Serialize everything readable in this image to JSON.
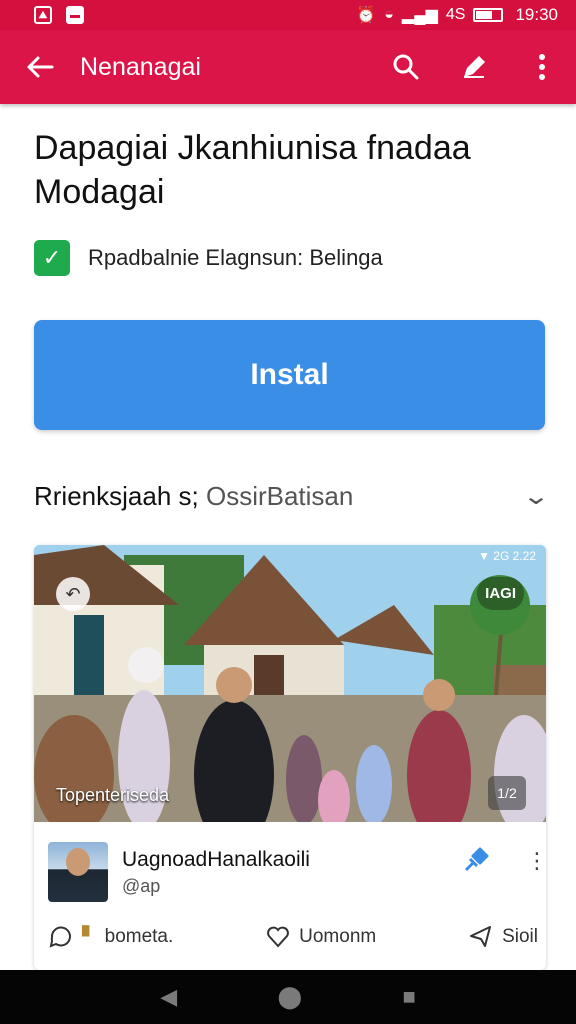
{
  "status_bar": {
    "left_icons": [
      "image-icon",
      "message-icon"
    ],
    "network_label": "4S",
    "time": "19:30"
  },
  "app_bar": {
    "title": "Nenanagai",
    "actions": [
      "search-icon",
      "edit-icon",
      "more-vert-icon"
    ]
  },
  "main": {
    "heading": "Dapagiai Jkanhiunisa fnadaa Modagai",
    "verified_text": "Rpadbalnie Elagnsun: Belinga",
    "install_label": "Instal",
    "section_title": "Rrienksjaah s;",
    "section_subtitle": "OssirBatisan"
  },
  "card": {
    "photo_caption": "Topenteriseda",
    "photo_badge": "IAGI",
    "photo_status": "▼ 2G 2.22",
    "fab_label": "1/2",
    "author_name": "UagnoadHanalkaoili",
    "author_handle": "@ap",
    "actions": {
      "comment": "bometa.",
      "like": "Uomonm",
      "share": "Sioil"
    }
  },
  "colors": {
    "app_bar": "#dc1548",
    "status_bar": "#d4103f",
    "install_button": "#3a8ee6",
    "check": "#1faa4e"
  }
}
